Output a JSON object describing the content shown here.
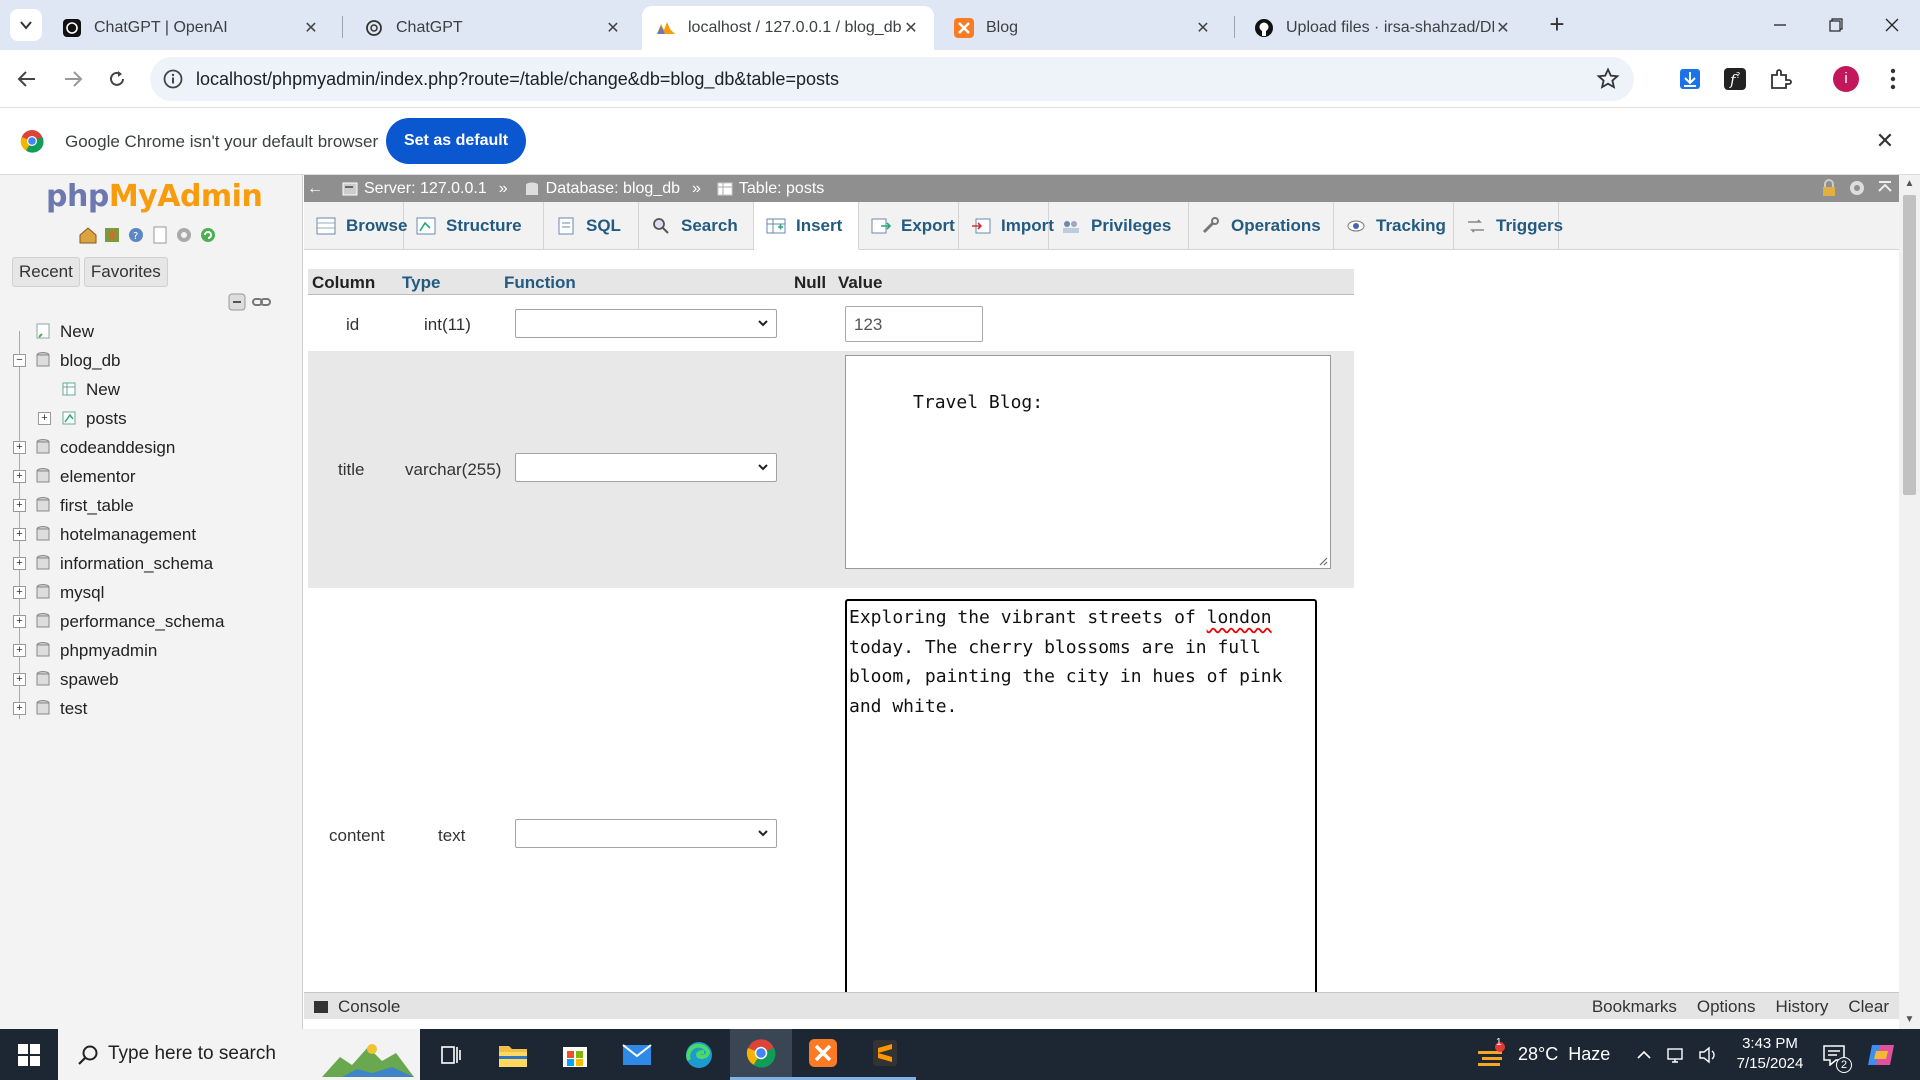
{
  "browser": {
    "tabs": [
      {
        "title": "ChatGPT | OpenAI",
        "icon": "openai-icon"
      },
      {
        "title": "ChatGPT",
        "icon": "openai-icon"
      },
      {
        "title": "localhost / 127.0.0.1 / blog_db /",
        "icon": "phpmyadmin-icon"
      },
      {
        "title": "Blog",
        "icon": "xampp-icon"
      },
      {
        "title": "Upload files · irsa-shahzad/DEP",
        "icon": "github-icon"
      }
    ],
    "active_tab_index": 2,
    "url": "localhost/phpmyadmin/index.php?route=/table/change&db=blog_db&table=posts",
    "profile_initial": "i",
    "infobar": {
      "message": "Google Chrome isn't your default browser",
      "button": "Set as default"
    }
  },
  "pma": {
    "logo": {
      "php": "php",
      "my": "My",
      "admin": "Admin"
    },
    "nav_tabs": {
      "recent": "Recent",
      "favorites": "Favorites"
    },
    "tree": {
      "new_top": "New",
      "blog_db": "blog_db",
      "blog_db_new": "New",
      "posts": "posts",
      "databases": [
        "codeanddesign",
        "elementor",
        "first_table",
        "hotelmanagement",
        "information_schema",
        "mysql",
        "performance_schema",
        "phpmyadmin",
        "spaweb",
        "test"
      ]
    },
    "breadcrumb": {
      "server": "Server: 127.0.0.1",
      "database": "Database: blog_db",
      "table": "Table: posts",
      "sep": "»"
    },
    "tabs": [
      "Browse",
      "Structure",
      "SQL",
      "Search",
      "Insert",
      "Export",
      "Import",
      "Privileges",
      "Operations",
      "Tracking",
      "Triggers"
    ],
    "active_tab": "Insert",
    "table_headers": {
      "column": "Column",
      "type": "Type",
      "function": "Function",
      "null": "Null",
      "value": "Value"
    },
    "rows": [
      {
        "column": "id",
        "type": "int(11)",
        "function": "",
        "value": "123"
      },
      {
        "column": "title",
        "type": "varchar(255)",
        "function": "",
        "value": "Travel Blog:"
      },
      {
        "column": "content",
        "type": "text",
        "function": "",
        "value_lines": [
          "Exploring the vibrant streets of ",
          "london",
          "today. The cherry blossoms are in full",
          "bloom, painting the city in hues of pink",
          "and white."
        ]
      }
    ],
    "console": {
      "label": "Console",
      "links": [
        "Bookmarks",
        "Options",
        "History",
        "Clear"
      ]
    }
  },
  "taskbar": {
    "search_placeholder": "Type here to search",
    "weather": "28°C  Haze",
    "weather_badge": "1",
    "time": "3:43 PM",
    "date": "7/15/2024",
    "notification_count": "2"
  },
  "colors": {
    "tab_strip": "#dfe7f4",
    "accent_blue": "#0b57d0",
    "pma_link": "#235a81",
    "pma_breadcrumb": "#8f8f8f",
    "taskbar": "#1c2733"
  }
}
